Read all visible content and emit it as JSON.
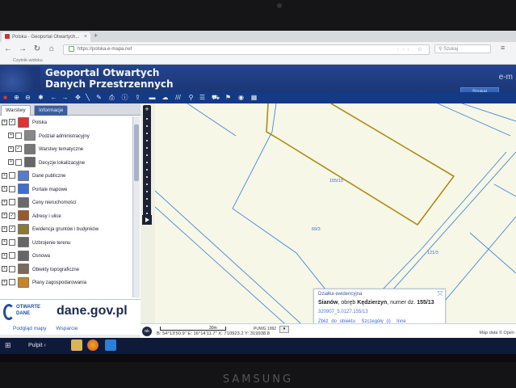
{
  "browser": {
    "tab_title": "Polska - Geoportal Otwartych...",
    "url": "https://polska.e-mapa.net",
    "search_placeholder": "Szukaj",
    "reader_text": "Czytnik widoku"
  },
  "portal": {
    "title_line1": "Geoportal Otwartych",
    "title_line2": "Danych Przestrzennych",
    "brand_right": "e-m",
    "search_button": "Szukaj"
  },
  "left_panel": {
    "tabs": [
      "Warstwy",
      "Informacje"
    ],
    "layers": [
      {
        "label": "Polska",
        "checked": true,
        "indent": 0,
        "icon_color": "#d33"
      },
      {
        "label": "Podział administracyjny",
        "checked": false,
        "indent": 1,
        "icon_color": "#888"
      },
      {
        "label": "Warstwy tematyczne",
        "checked": true,
        "indent": 1,
        "icon_color": "#777"
      },
      {
        "label": "Decyzje lokalizacyjne",
        "checked": false,
        "indent": 1,
        "icon_color": "#666"
      },
      {
        "label": "Dane publiczne",
        "checked": false,
        "indent": 0,
        "icon_color": "#5a7bc8"
      },
      {
        "label": "Portale mapowe",
        "checked": false,
        "indent": 0,
        "icon_color": "#3c6fd0"
      },
      {
        "label": "Ceny nieruchomości",
        "checked": false,
        "indent": 0,
        "icon_color": "#6a6a6a"
      },
      {
        "label": "Adresy i ulice",
        "checked": true,
        "indent": 0,
        "icon_color": "#9a5a2a"
      },
      {
        "label": "Ewidencja gruntów i budynków",
        "checked": true,
        "indent": 0,
        "icon_color": "#8a7a3a"
      },
      {
        "label": "Uzbrojenie terenu",
        "checked": false,
        "indent": 0,
        "icon_color": "#666"
      },
      {
        "label": "Osnowa",
        "checked": false,
        "indent": 0,
        "icon_color": "#666"
      },
      {
        "label": "Obiekty topograficzne",
        "checked": false,
        "indent": 0,
        "icon_color": "#7a6a5a"
      },
      {
        "label": "Plany zagospodarowania",
        "checked": false,
        "indent": 0,
        "icon_color": "#c8842a"
      }
    ],
    "logo_small1": "OTWARTE",
    "logo_small2": "DANE",
    "logo_big": "dane.gov.pl",
    "footer_link1": "Podgląd mapy",
    "footer_link2": "Wsparcie"
  },
  "map": {
    "parcel_labels": [
      "155/13",
      "69/3",
      "121/3"
    ],
    "highlight_color": "#b08a1a",
    "line_color": "#4a86d8"
  },
  "info_popup": {
    "title": "Działka ewidencyjna",
    "main_bold": "Sianów",
    "main_mid": ", obręb ",
    "main_bold2": "Kędzierzyn",
    "main_tail": ", numer dz. ",
    "main_number": "155/13",
    "parcel_id": "320907_5.0127.155/13",
    "link1": "Zbliż do obiektu",
    "link2": "Szczegóły (i)",
    "link3": "Inne"
  },
  "status": {
    "ok": "ok",
    "scale": "30m",
    "coords": "B: 54°13'50.9\"   E: 16°14'11.7\"     X: 710923.2     Y: 319938.8",
    "crs": "PUWG 1992",
    "attribution": "Map data © Open"
  },
  "taskbar": {
    "start": "⊞",
    "pulpit": "Pulpit"
  },
  "laptop_brand": "SAMSUNG"
}
